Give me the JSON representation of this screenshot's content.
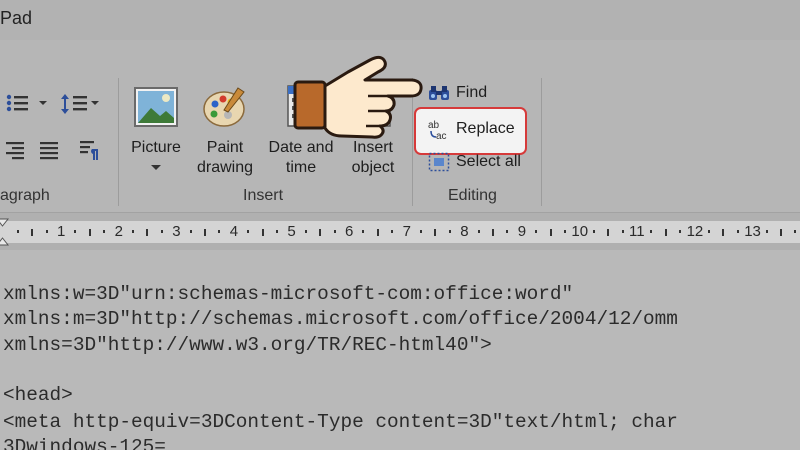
{
  "window": {
    "title": "Pad"
  },
  "ribbon": {
    "paragraph": {
      "group_label": "agraph"
    },
    "insert": {
      "group_label": "Insert",
      "buttons": [
        {
          "label_1": "Picture",
          "label_2": ""
        },
        {
          "label_1": "Paint",
          "label_2": "drawing"
        },
        {
          "label_1": "Date and",
          "label_2": "time"
        },
        {
          "label_1": "Insert",
          "label_2": "object"
        }
      ]
    },
    "editing": {
      "group_label": "Editing",
      "find": "Find",
      "replace": "Replace",
      "select_all": "Select all"
    }
  },
  "ruler": {
    "numbers": [
      "1",
      "2",
      "3",
      "4",
      "5",
      "6",
      "7",
      "8",
      "9",
      "10",
      "11",
      "12",
      "13"
    ]
  },
  "document": {
    "lines": [
      "xmlns:w=3D\"urn:schemas-microsoft-com:office:word\"",
      "xmlns:m=3D\"http://schemas.microsoft.com/office/2004/12/omm",
      "xmlns=3D\"http://www.w3.org/TR/REC-html40\">",
      "",
      "<head>",
      "<meta http-equiv=3DContent-Type content=3D\"text/html; char",
      "3Dwindows-125="
    ]
  },
  "colors": {
    "highlight_border": "#d63a3a",
    "pointer_cuff": "#b8692b"
  }
}
